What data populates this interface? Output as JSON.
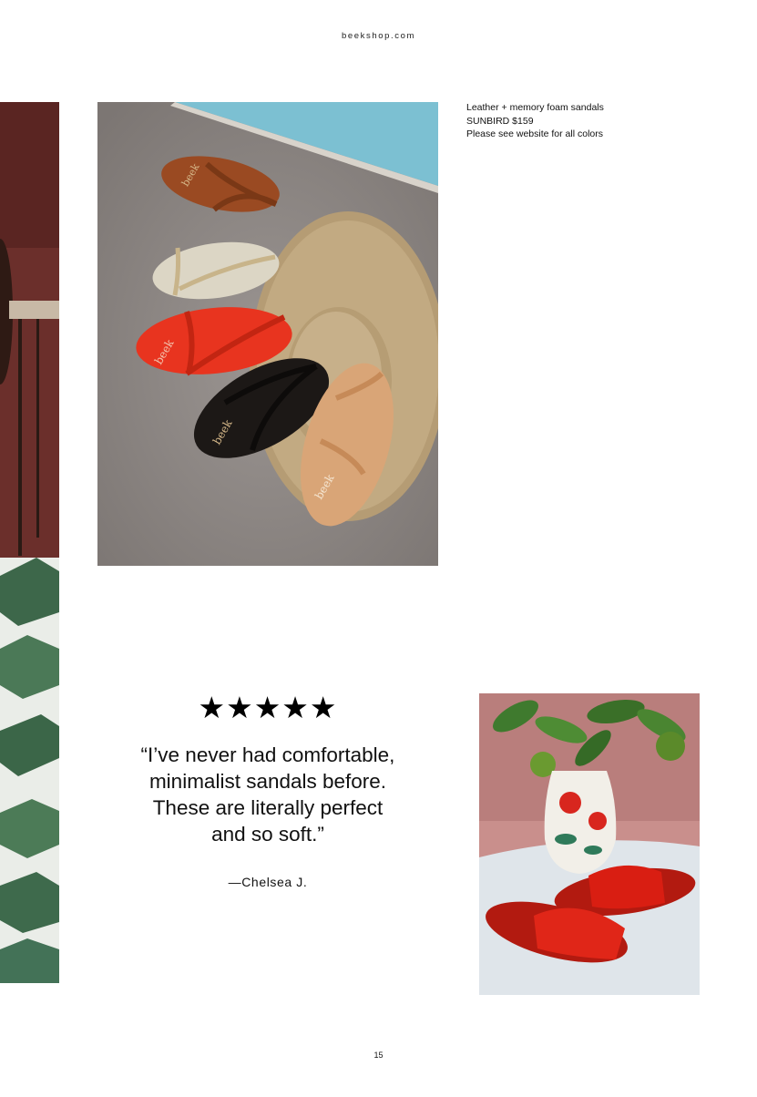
{
  "header": {
    "site_url": "beekshop.com"
  },
  "product": {
    "lines": [
      "Leather + memory foam sandals",
      "SUNBIRD $159",
      "Please see website for all colors"
    ],
    "brand_mark": "beek"
  },
  "review": {
    "stars": "★★★★★",
    "rating": 5,
    "quote_lines": [
      "“I’ve never had comfortable,",
      "minimalist sandals before.",
      "These are literally perfect",
      "and so soft.”"
    ],
    "author": "—Chelsea J."
  },
  "footer": {
    "page_number": "15"
  },
  "colors": {
    "sandal_brown": "#9a4a22",
    "sandal_gold": "#d9d3c2",
    "sandal_red": "#e8341f",
    "sandal_black": "#1c1816",
    "sandal_tan": "#d9a577",
    "slide_red": "#d91e12",
    "wall_pink": "#c98f8c"
  }
}
